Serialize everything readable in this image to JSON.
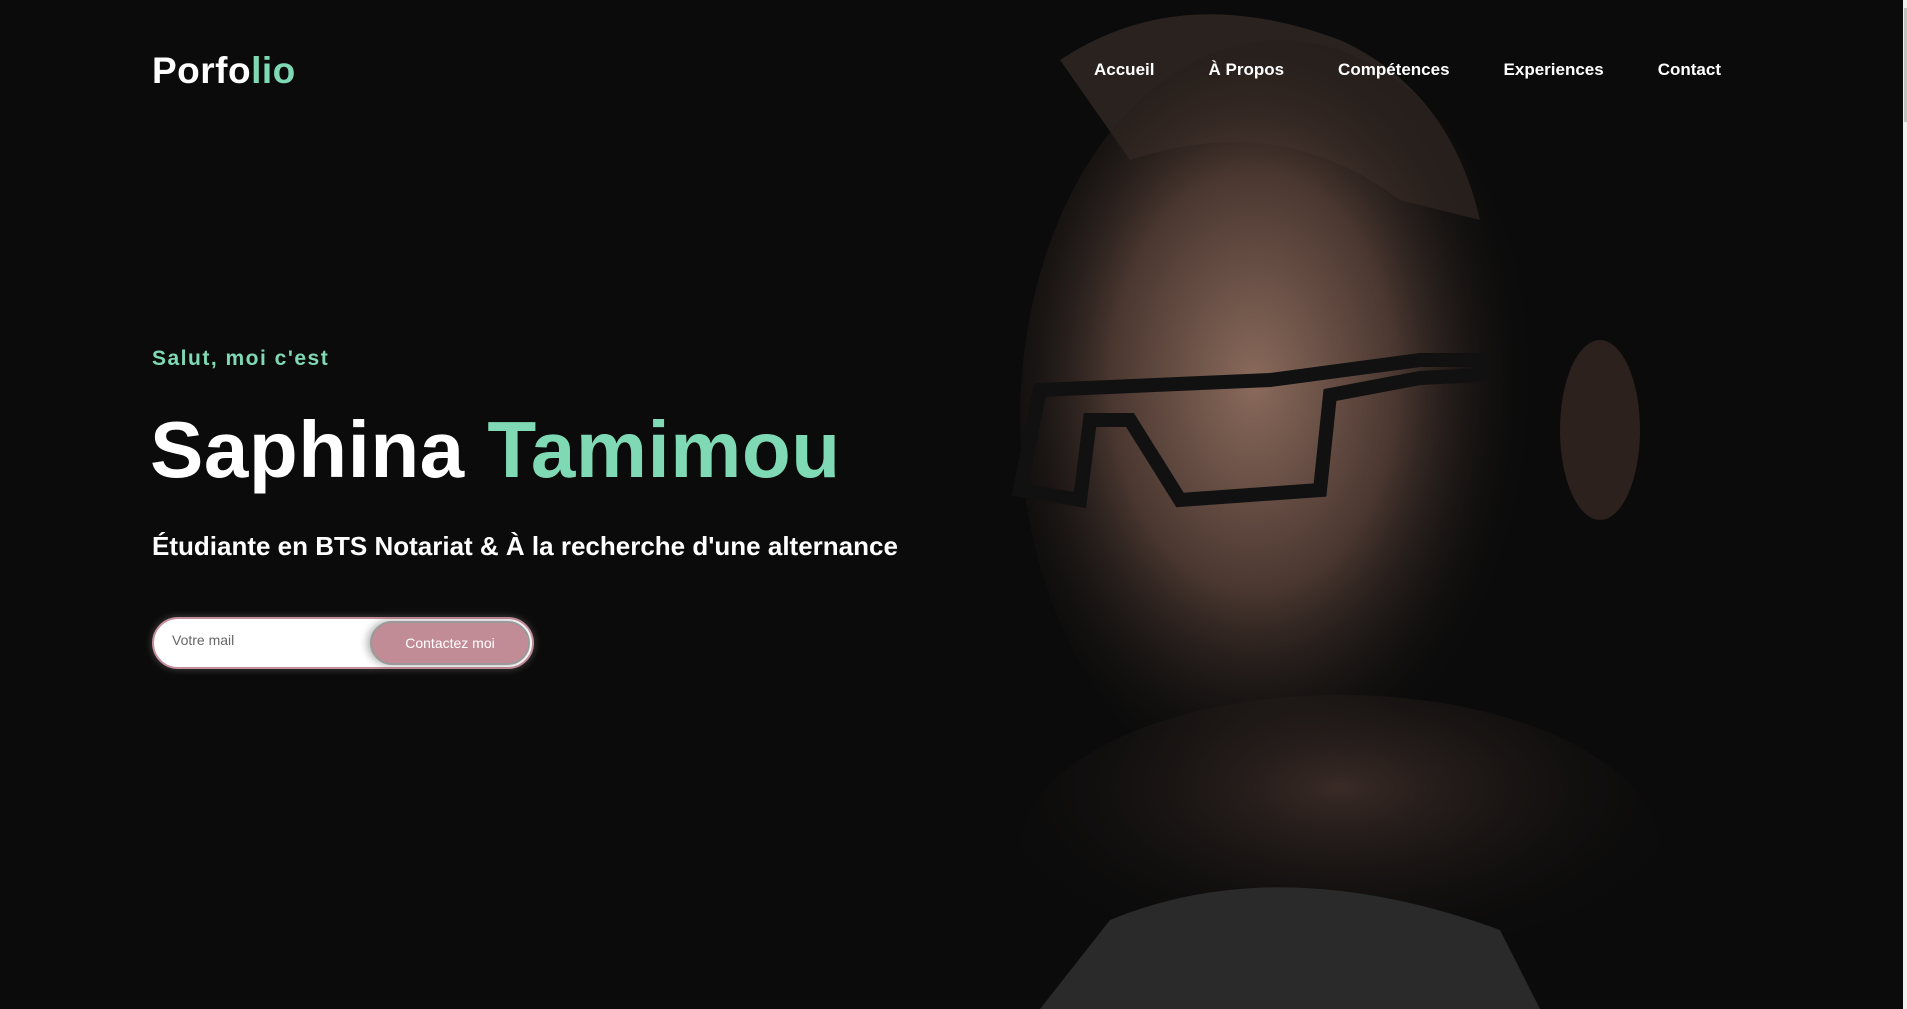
{
  "logo": {
    "part1": "Porfo",
    "part2": "lio"
  },
  "nav": [
    "Accueil",
    "À Propos",
    "Compétences",
    "Experiences",
    "Contact"
  ],
  "hero": {
    "greeting": "Salut, moi c'est",
    "first_name": "Saphina",
    "last_name": "Tamimou",
    "subtitle": "Étudiante en BTS Notariat & À la recherche d'une alternance",
    "email_placeholder": "Votre mail",
    "cta": "Contactez moi"
  },
  "colors": {
    "accent": "#7fd9b5",
    "button": "#c28c97",
    "background": "#0b0b0b"
  }
}
